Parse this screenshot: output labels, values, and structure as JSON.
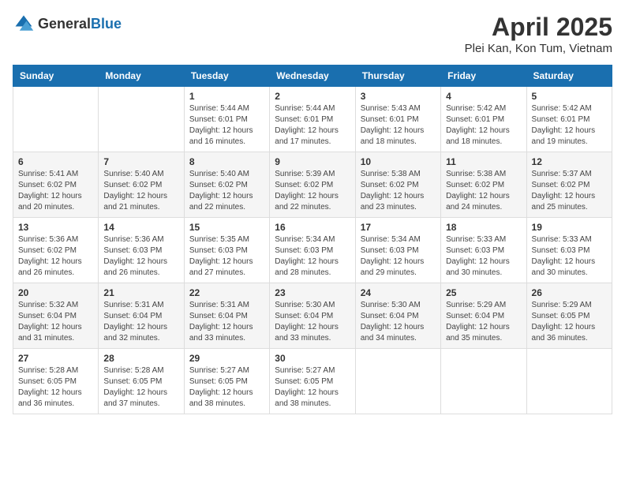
{
  "header": {
    "logo_general": "General",
    "logo_blue": "Blue",
    "title": "April 2025",
    "location": "Plei Kan, Kon Tum, Vietnam"
  },
  "calendar": {
    "days_of_week": [
      "Sunday",
      "Monday",
      "Tuesday",
      "Wednesday",
      "Thursday",
      "Friday",
      "Saturday"
    ],
    "weeks": [
      [
        {
          "day": "",
          "sunrise": "",
          "sunset": "",
          "daylight": ""
        },
        {
          "day": "",
          "sunrise": "",
          "sunset": "",
          "daylight": ""
        },
        {
          "day": "1",
          "sunrise": "Sunrise: 5:44 AM",
          "sunset": "Sunset: 6:01 PM",
          "daylight": "Daylight: 12 hours and 16 minutes."
        },
        {
          "day": "2",
          "sunrise": "Sunrise: 5:44 AM",
          "sunset": "Sunset: 6:01 PM",
          "daylight": "Daylight: 12 hours and 17 minutes."
        },
        {
          "day": "3",
          "sunrise": "Sunrise: 5:43 AM",
          "sunset": "Sunset: 6:01 PM",
          "daylight": "Daylight: 12 hours and 18 minutes."
        },
        {
          "day": "4",
          "sunrise": "Sunrise: 5:42 AM",
          "sunset": "Sunset: 6:01 PM",
          "daylight": "Daylight: 12 hours and 18 minutes."
        },
        {
          "day": "5",
          "sunrise": "Sunrise: 5:42 AM",
          "sunset": "Sunset: 6:01 PM",
          "daylight": "Daylight: 12 hours and 19 minutes."
        }
      ],
      [
        {
          "day": "6",
          "sunrise": "Sunrise: 5:41 AM",
          "sunset": "Sunset: 6:02 PM",
          "daylight": "Daylight: 12 hours and 20 minutes."
        },
        {
          "day": "7",
          "sunrise": "Sunrise: 5:40 AM",
          "sunset": "Sunset: 6:02 PM",
          "daylight": "Daylight: 12 hours and 21 minutes."
        },
        {
          "day": "8",
          "sunrise": "Sunrise: 5:40 AM",
          "sunset": "Sunset: 6:02 PM",
          "daylight": "Daylight: 12 hours and 22 minutes."
        },
        {
          "day": "9",
          "sunrise": "Sunrise: 5:39 AM",
          "sunset": "Sunset: 6:02 PM",
          "daylight": "Daylight: 12 hours and 22 minutes."
        },
        {
          "day": "10",
          "sunrise": "Sunrise: 5:38 AM",
          "sunset": "Sunset: 6:02 PM",
          "daylight": "Daylight: 12 hours and 23 minutes."
        },
        {
          "day": "11",
          "sunrise": "Sunrise: 5:38 AM",
          "sunset": "Sunset: 6:02 PM",
          "daylight": "Daylight: 12 hours and 24 minutes."
        },
        {
          "day": "12",
          "sunrise": "Sunrise: 5:37 AM",
          "sunset": "Sunset: 6:02 PM",
          "daylight": "Daylight: 12 hours and 25 minutes."
        }
      ],
      [
        {
          "day": "13",
          "sunrise": "Sunrise: 5:36 AM",
          "sunset": "Sunset: 6:02 PM",
          "daylight": "Daylight: 12 hours and 26 minutes."
        },
        {
          "day": "14",
          "sunrise": "Sunrise: 5:36 AM",
          "sunset": "Sunset: 6:03 PM",
          "daylight": "Daylight: 12 hours and 26 minutes."
        },
        {
          "day": "15",
          "sunrise": "Sunrise: 5:35 AM",
          "sunset": "Sunset: 6:03 PM",
          "daylight": "Daylight: 12 hours and 27 minutes."
        },
        {
          "day": "16",
          "sunrise": "Sunrise: 5:34 AM",
          "sunset": "Sunset: 6:03 PM",
          "daylight": "Daylight: 12 hours and 28 minutes."
        },
        {
          "day": "17",
          "sunrise": "Sunrise: 5:34 AM",
          "sunset": "Sunset: 6:03 PM",
          "daylight": "Daylight: 12 hours and 29 minutes."
        },
        {
          "day": "18",
          "sunrise": "Sunrise: 5:33 AM",
          "sunset": "Sunset: 6:03 PM",
          "daylight": "Daylight: 12 hours and 30 minutes."
        },
        {
          "day": "19",
          "sunrise": "Sunrise: 5:33 AM",
          "sunset": "Sunset: 6:03 PM",
          "daylight": "Daylight: 12 hours and 30 minutes."
        }
      ],
      [
        {
          "day": "20",
          "sunrise": "Sunrise: 5:32 AM",
          "sunset": "Sunset: 6:04 PM",
          "daylight": "Daylight: 12 hours and 31 minutes."
        },
        {
          "day": "21",
          "sunrise": "Sunrise: 5:31 AM",
          "sunset": "Sunset: 6:04 PM",
          "daylight": "Daylight: 12 hours and 32 minutes."
        },
        {
          "day": "22",
          "sunrise": "Sunrise: 5:31 AM",
          "sunset": "Sunset: 6:04 PM",
          "daylight": "Daylight: 12 hours and 33 minutes."
        },
        {
          "day": "23",
          "sunrise": "Sunrise: 5:30 AM",
          "sunset": "Sunset: 6:04 PM",
          "daylight": "Daylight: 12 hours and 33 minutes."
        },
        {
          "day": "24",
          "sunrise": "Sunrise: 5:30 AM",
          "sunset": "Sunset: 6:04 PM",
          "daylight": "Daylight: 12 hours and 34 minutes."
        },
        {
          "day": "25",
          "sunrise": "Sunrise: 5:29 AM",
          "sunset": "Sunset: 6:04 PM",
          "daylight": "Daylight: 12 hours and 35 minutes."
        },
        {
          "day": "26",
          "sunrise": "Sunrise: 5:29 AM",
          "sunset": "Sunset: 6:05 PM",
          "daylight": "Daylight: 12 hours and 36 minutes."
        }
      ],
      [
        {
          "day": "27",
          "sunrise": "Sunrise: 5:28 AM",
          "sunset": "Sunset: 6:05 PM",
          "daylight": "Daylight: 12 hours and 36 minutes."
        },
        {
          "day": "28",
          "sunrise": "Sunrise: 5:28 AM",
          "sunset": "Sunset: 6:05 PM",
          "daylight": "Daylight: 12 hours and 37 minutes."
        },
        {
          "day": "29",
          "sunrise": "Sunrise: 5:27 AM",
          "sunset": "Sunset: 6:05 PM",
          "daylight": "Daylight: 12 hours and 38 minutes."
        },
        {
          "day": "30",
          "sunrise": "Sunrise: 5:27 AM",
          "sunset": "Sunset: 6:05 PM",
          "daylight": "Daylight: 12 hours and 38 minutes."
        },
        {
          "day": "",
          "sunrise": "",
          "sunset": "",
          "daylight": ""
        },
        {
          "day": "",
          "sunrise": "",
          "sunset": "",
          "daylight": ""
        },
        {
          "day": "",
          "sunrise": "",
          "sunset": "",
          "daylight": ""
        }
      ]
    ]
  }
}
